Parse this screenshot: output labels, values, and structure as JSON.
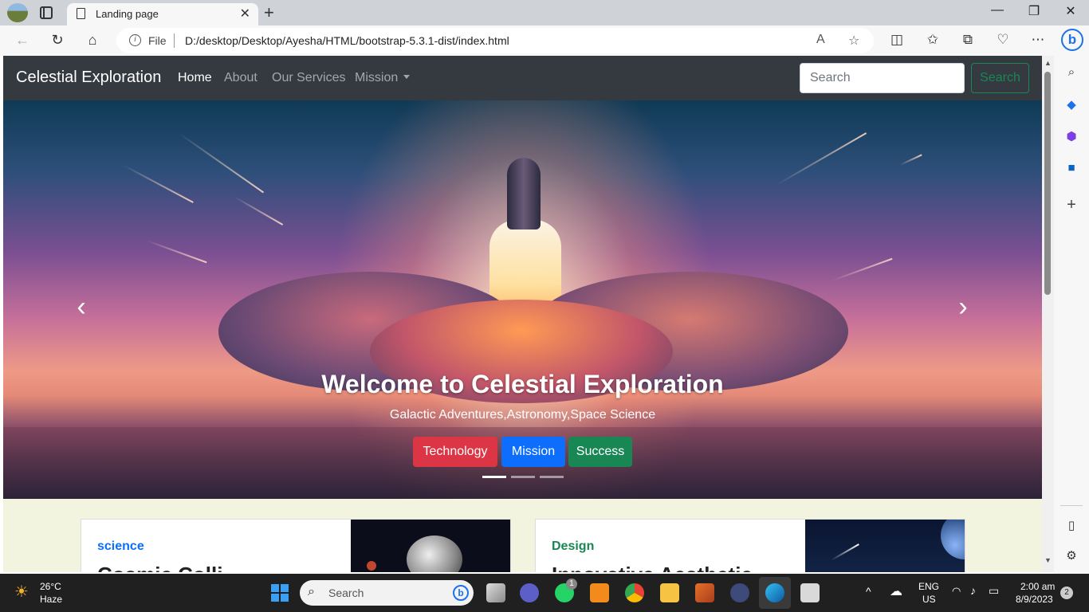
{
  "browser": {
    "tab_title": "Landing page",
    "tab_close": "✕",
    "new_tab": "+",
    "address_prefix": "File",
    "url": "D:/desktop/Desktop/Ayesha/HTML/bootstrap-5.3.1-dist/index.html",
    "window_controls": [
      "—",
      "❐",
      "✕"
    ]
  },
  "site": {
    "brand": "Celestial Exploration",
    "nav": [
      {
        "label": "Home",
        "active": true
      },
      {
        "label": "About",
        "active": false
      },
      {
        "label": "Our Services",
        "active": false
      },
      {
        "label": "Mission",
        "active": false
      }
    ],
    "search_placeholder": "Search",
    "search_button": "Search"
  },
  "hero": {
    "title": "Welcome to Celestial Exploration",
    "subtitle": "Galactic Adventures,Astronomy,Space Science",
    "buttons": [
      {
        "label": "Technology",
        "color": "#dc3545"
      },
      {
        "label": "Mission",
        "color": "#0d6efd"
      },
      {
        "label": "Success",
        "color": "#198754"
      }
    ],
    "prev": "‹",
    "next": "›",
    "active_slide": 1,
    "slide_count": 3
  },
  "cards": [
    {
      "category": "science",
      "category_color": "#0d6efd",
      "title": "Cosmic Colli"
    },
    {
      "category": "Design",
      "category_color": "#198754",
      "title": "Innovative Aesthetic"
    }
  ],
  "taskbar": {
    "weather_temp": "26°C",
    "weather_desc": "Haze",
    "search_label": "Search",
    "whatsapp_badge": "1",
    "lang_top": "ENG",
    "lang_bottom": "US",
    "time": "2:00 am",
    "date": "8/9/2023",
    "notification_count": "2"
  }
}
